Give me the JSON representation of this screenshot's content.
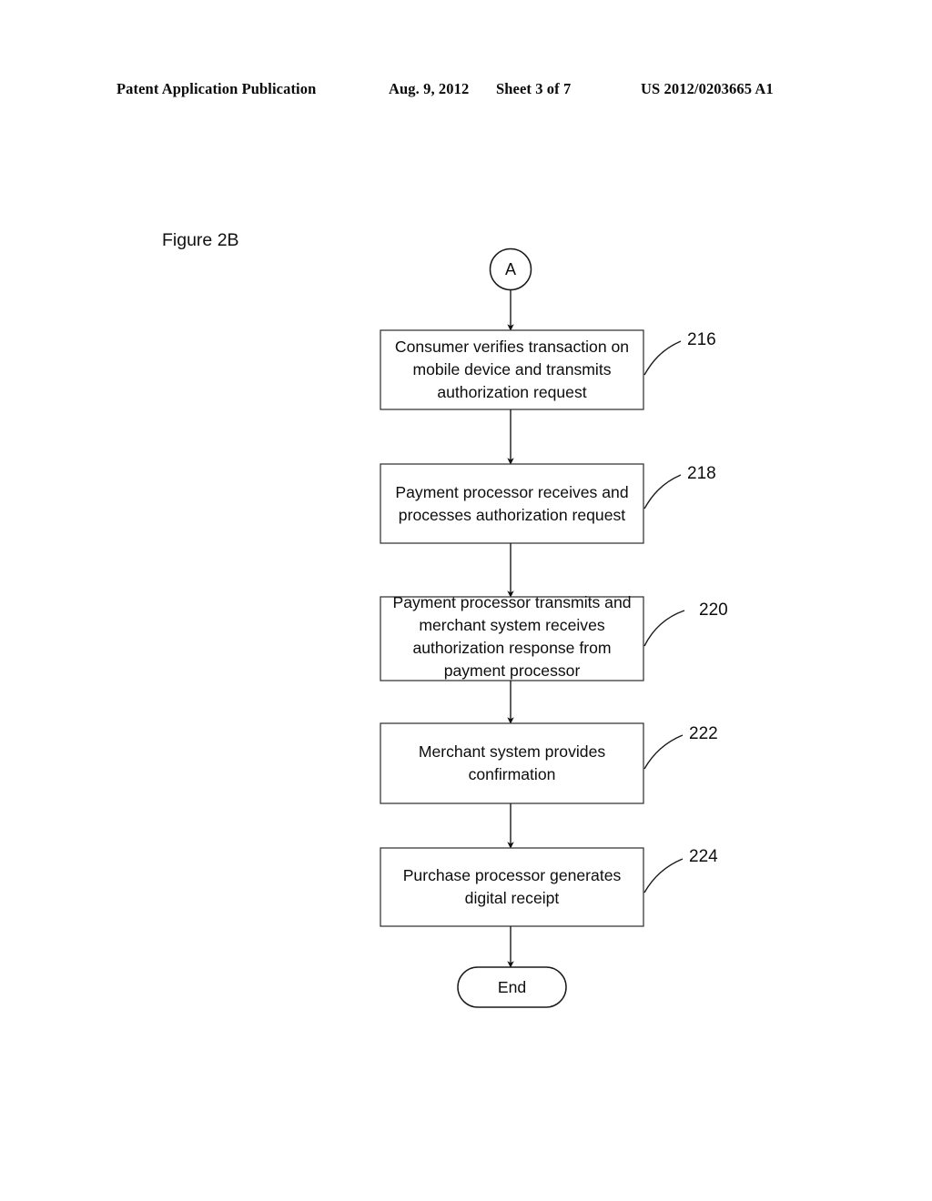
{
  "header": {
    "publication": "Patent Application Publication",
    "date": "Aug. 9, 2012",
    "sheet": "Sheet 3 of 7",
    "patent_number": "US 2012/0203665 A1"
  },
  "figure": {
    "label": "Figure 2B",
    "start_connector": "A",
    "end_terminal": "End"
  },
  "nodes": [
    {
      "ref": "216",
      "text": "Consumer verifies transaction on mobile device and transmits authorization request",
      "lines": [
        "Consumer verifies transaction",
        "on mobile device and transmits",
        "authorization request"
      ]
    },
    {
      "ref": "218",
      "text": "Payment processor receives and processes authorization request",
      "lines": [
        "Payment processor receives",
        "and processes authorization",
        "request"
      ]
    },
    {
      "ref": "220",
      "text": "Payment processor transmits and merchant system receives authorization response from payment processor",
      "lines": [
        "Payment processor transmits",
        "and merchant system receives",
        "authorization response from",
        "payment processor"
      ]
    },
    {
      "ref": "222",
      "text": "Merchant system provides confirmation",
      "lines": [
        "Merchant system provides",
        "confirmation"
      ]
    },
    {
      "ref": "224",
      "text": "Purchase processor generates digital receipt",
      "lines": [
        "Purchase processor generates",
        "digital receipt"
      ]
    }
  ],
  "colors": {
    "ink": "#000000",
    "page": "#ffffff"
  }
}
